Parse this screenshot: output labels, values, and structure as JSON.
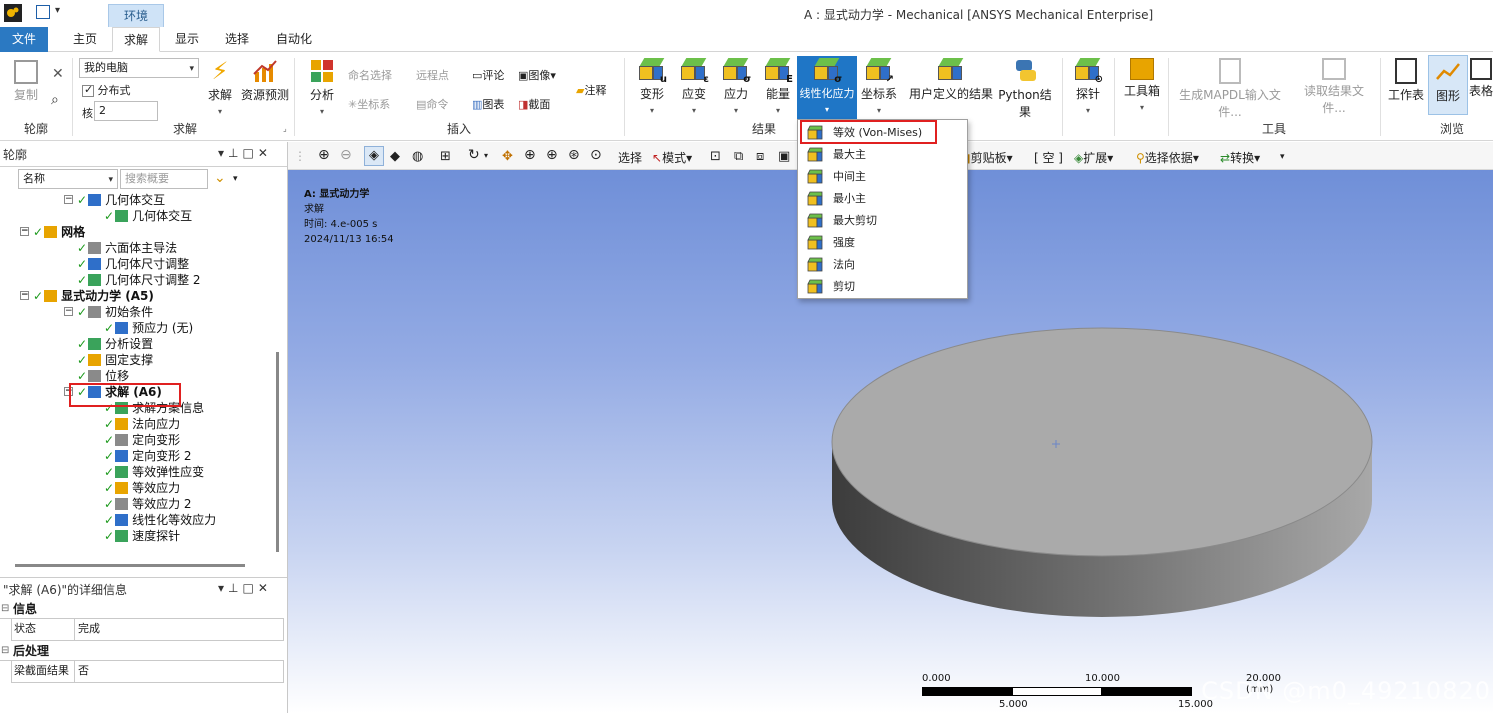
{
  "window": {
    "title": "A : 显式动力学 - Mechanical [ANSYS Mechanical Enterprise]",
    "context_tab": "环境"
  },
  "tabs": [
    "文件",
    "主页",
    "求解",
    "显示",
    "选择",
    "自动化"
  ],
  "ribbon": {
    "solve_group": {
      "label": "轮廓",
      "copy": "复制",
      "computer": "我的电脑",
      "distributed": "分布式",
      "cores_label": "核",
      "cores": "2",
      "solve": "求解",
      "resource": "资源预测",
      "group_label": "求解"
    },
    "insert_group": {
      "analysis": "分析",
      "named_sel": "命名选择",
      "remote_point": "远程点",
      "comment": "评论",
      "image": "图像",
      "annotation": "注释",
      "coord": "坐标系",
      "command": "命令",
      "chart": "图表",
      "section": "截面",
      "group_label": "插入"
    },
    "results_group": {
      "deformation": "变形",
      "strain": "应变",
      "stress": "应力",
      "energy": "能量",
      "linearized": "线性化应力",
      "coord_sys": "坐标系",
      "user_defined": "用户定义的结果",
      "python": "Python结果",
      "group_label": "结果"
    },
    "tools_group": {
      "probe": "探针",
      "toolbox": "工具箱",
      "gen_mapdl": "生成MAPDL输入文件...",
      "read_results": "读取结果文件...",
      "group_label": "工具"
    },
    "browse_group": {
      "worksheet": "工作表",
      "graphics": "图形",
      "table": "表格",
      "group_label": "浏览"
    }
  },
  "outline": {
    "title": "轮廓",
    "filter_field": "名称",
    "search_placeholder": "搜索概要",
    "items": [
      {
        "label": "几何体交互",
        "level": 2
      },
      {
        "label": "几何体交互",
        "level": 3
      },
      {
        "label": "网格",
        "level": 1
      },
      {
        "label": "六面体主导法",
        "level": 2
      },
      {
        "label": "几何体尺寸调整",
        "level": 2
      },
      {
        "label": "几何体尺寸调整 2",
        "level": 2
      },
      {
        "label": "显式动力学 (A5)",
        "level": 1
      },
      {
        "label": "初始条件",
        "level": 2
      },
      {
        "label": "预应力 (无)",
        "level": 3
      },
      {
        "label": "分析设置",
        "level": 2
      },
      {
        "label": "固定支撑",
        "level": 2
      },
      {
        "label": "位移",
        "level": 2
      },
      {
        "label": "求解 (A6)",
        "level": 2
      },
      {
        "label": "求解方案信息",
        "level": 3
      },
      {
        "label": "法向应力",
        "level": 3
      },
      {
        "label": "定向变形",
        "level": 3
      },
      {
        "label": "定向变形 2",
        "level": 3
      },
      {
        "label": "等效弹性应变",
        "level": 3
      },
      {
        "label": "等效应力",
        "level": 3
      },
      {
        "label": "等效应力 2",
        "level": 3
      },
      {
        "label": "线性化等效应力",
        "level": 3
      },
      {
        "label": "速度探针",
        "level": 3
      }
    ]
  },
  "details": {
    "title": "\"求解 (A6)\"的详细信息",
    "sections": [
      {
        "name": "信息",
        "rows": [
          {
            "key": "状态",
            "value": "完成"
          }
        ]
      },
      {
        "name": "后处理",
        "rows": [
          {
            "key": "梁截面结果",
            "value": "否"
          }
        ]
      }
    ]
  },
  "graphics_toolbar": {
    "select": "选择",
    "mode": "模式",
    "clipboard": "剪贴板",
    "empty": "[ 空 ]",
    "expand": "扩展",
    "select_by": "选择依据",
    "convert": "转换"
  },
  "viewport": {
    "title": "A: 显式动力学",
    "subtitle": "求解",
    "time": "时间: 4.e-005 s",
    "date": "2024/11/13 16:54",
    "scale_labels": [
      "0.000",
      "10.000",
      "20.000 (mm)",
      "5.000",
      "15.000"
    ],
    "watermark": "CSDN @m0_49210820"
  },
  "linearized_menu": {
    "items": [
      "等效 (Von-Mises)",
      "最大主",
      "中间主",
      "最小主",
      "最大剪切",
      "强度",
      "法向",
      "剪切"
    ],
    "highlighted": "等效 (Von-Mises)"
  },
  "colors": {
    "accent": "#2b79c2",
    "highlight_box": "#e02020",
    "check": "#1e9a1e"
  }
}
